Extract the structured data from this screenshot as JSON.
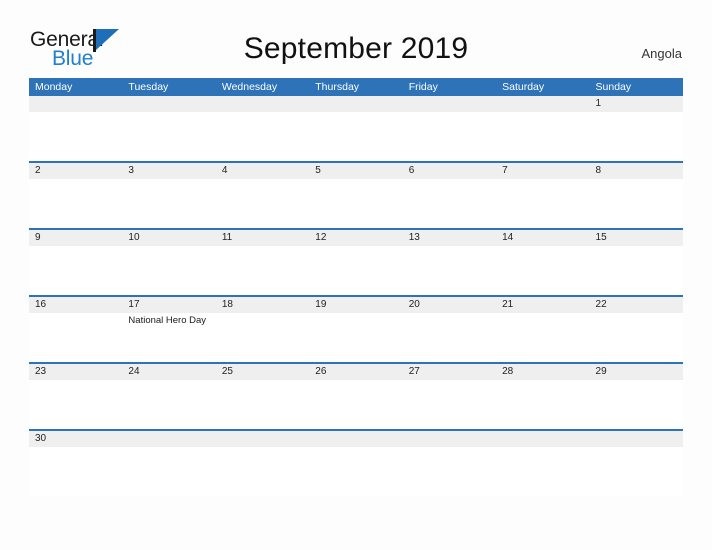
{
  "brand": {
    "word_one": "General",
    "word_two": "Blue",
    "flag_icon": "blue-triangle-flag"
  },
  "header": {
    "title": "September 2019",
    "country": "Angola"
  },
  "colors": {
    "header_blue": "#2e72b8",
    "band_gray": "#efefef",
    "brand_blue": "#1f7fd0",
    "page_background": "#fdfdfd",
    "text": "#1a1a1a"
  },
  "calendar": {
    "day_names": [
      "Monday",
      "Tuesday",
      "Wednesday",
      "Thursday",
      "Friday",
      "Saturday",
      "Sunday"
    ],
    "weeks": [
      {
        "days": [
          {
            "num": "",
            "events": []
          },
          {
            "num": "",
            "events": []
          },
          {
            "num": "",
            "events": []
          },
          {
            "num": "",
            "events": []
          },
          {
            "num": "",
            "events": []
          },
          {
            "num": "",
            "events": []
          },
          {
            "num": "1",
            "events": []
          }
        ]
      },
      {
        "days": [
          {
            "num": "2",
            "events": []
          },
          {
            "num": "3",
            "events": []
          },
          {
            "num": "4",
            "events": []
          },
          {
            "num": "5",
            "events": []
          },
          {
            "num": "6",
            "events": []
          },
          {
            "num": "7",
            "events": []
          },
          {
            "num": "8",
            "events": []
          }
        ]
      },
      {
        "days": [
          {
            "num": "9",
            "events": []
          },
          {
            "num": "10",
            "events": []
          },
          {
            "num": "11",
            "events": []
          },
          {
            "num": "12",
            "events": []
          },
          {
            "num": "13",
            "events": []
          },
          {
            "num": "14",
            "events": []
          },
          {
            "num": "15",
            "events": []
          }
        ]
      },
      {
        "days": [
          {
            "num": "16",
            "events": []
          },
          {
            "num": "17",
            "events": [
              "National Hero Day"
            ]
          },
          {
            "num": "18",
            "events": []
          },
          {
            "num": "19",
            "events": []
          },
          {
            "num": "20",
            "events": []
          },
          {
            "num": "21",
            "events": []
          },
          {
            "num": "22",
            "events": []
          }
        ]
      },
      {
        "days": [
          {
            "num": "23",
            "events": []
          },
          {
            "num": "24",
            "events": []
          },
          {
            "num": "25",
            "events": []
          },
          {
            "num": "26",
            "events": []
          },
          {
            "num": "27",
            "events": []
          },
          {
            "num": "28",
            "events": []
          },
          {
            "num": "29",
            "events": []
          }
        ]
      },
      {
        "days": [
          {
            "num": "30",
            "events": []
          },
          {
            "num": "",
            "events": []
          },
          {
            "num": "",
            "events": []
          },
          {
            "num": "",
            "events": []
          },
          {
            "num": "",
            "events": []
          },
          {
            "num": "",
            "events": []
          },
          {
            "num": "",
            "events": []
          }
        ]
      }
    ]
  }
}
